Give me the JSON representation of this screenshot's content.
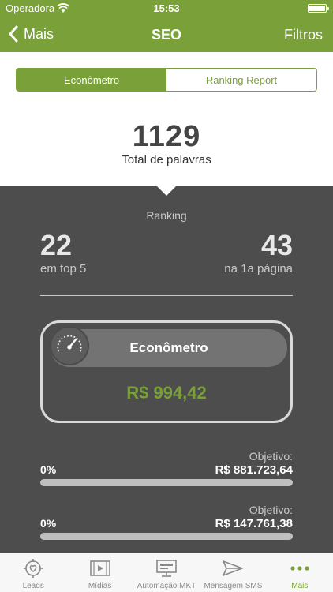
{
  "status_bar": {
    "carrier": "Operadora",
    "time": "15:53"
  },
  "nav": {
    "back_label": "Mais",
    "title": "SEO",
    "filters_label": "Filtros"
  },
  "segments": [
    {
      "label": "Econômetro",
      "active": true
    },
    {
      "label": "Ranking Report",
      "active": false
    }
  ],
  "summary": {
    "total_value": "1129",
    "total_label": "Total de palavras"
  },
  "ranking": {
    "label": "Ranking",
    "top5_value": "22",
    "top5_label": "em top 5",
    "first_page_value": "43",
    "first_page_label": "na 1a página"
  },
  "econometro": {
    "title": "Econômetro",
    "value": "R$ 994,42"
  },
  "goals": [
    {
      "objective_label": "Objetivo:",
      "percent_label": "0%",
      "value": "R$ 881.723,64",
      "progress": 0
    },
    {
      "objective_label": "Objetivo:",
      "percent_label": "0%",
      "value": "R$ 147.761,38",
      "progress": 0
    }
  ],
  "tabs": [
    {
      "label": "Leads",
      "icon": "leads-target-heart-icon",
      "active": false
    },
    {
      "label": "Mídias",
      "icon": "media-film-icon",
      "active": false
    },
    {
      "label": "Automação MKT",
      "icon": "automation-monitor-icon",
      "active": false
    },
    {
      "label": "Mensagem SMS",
      "icon": "send-paper-plane-icon",
      "active": false
    },
    {
      "label": "Mais",
      "icon": "more-dots-icon",
      "active": true
    }
  ],
  "colors": {
    "brand_green": "#7aa03a",
    "dark_bg": "#4d4d4d",
    "inactive_tab": "#8a8a8a"
  }
}
